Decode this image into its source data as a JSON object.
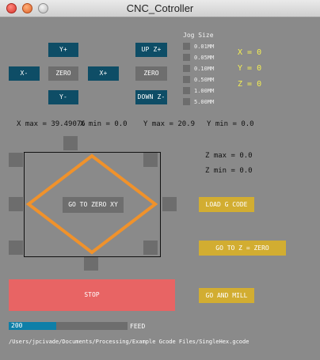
{
  "window": {
    "title": "CNC_Cotroller"
  },
  "jog_pad": {
    "y_plus": "Y+",
    "y_minus": "Y-",
    "x_minus": "X-",
    "x_plus": "X+",
    "zero": "ZERO"
  },
  "z_pad": {
    "up": "UP Z+",
    "zero": "ZERO",
    "down": "DOWN Z-"
  },
  "jog_size": {
    "title": "Jog  Size",
    "options": [
      "0.01MM",
      "0.05MM",
      "0.10MM",
      "0.50MM",
      "1.00MM",
      "5.00MM"
    ]
  },
  "position": {
    "x": "X = 0",
    "y": "Y = 0",
    "z": "Z = 0"
  },
  "limits": {
    "x_max": "X max = 39.49076",
    "x_min": "X min = 0.0",
    "y_max": "Y max = 20.9",
    "y_min": "Y min = 0.0",
    "z_max": "Z max = 0.0",
    "z_min": "Z min = 0.0"
  },
  "work_area": {
    "go_to_zero_xy": "GO TO ZERO XY"
  },
  "actions": {
    "load_gcode": "LOAD G CODE",
    "go_to_z_zero": "GO TO Z = ZERO",
    "go_and_mill": "GO AND MILL",
    "stop": "STOP"
  },
  "feed": {
    "value": 200,
    "max": 500,
    "value_text": "200",
    "label": "FEED"
  },
  "file_path": "/Users/jpcivade/Documents/Processing/Example Gcode Files/SingleHex.gcode",
  "colors": {
    "background": "#8a8a8a",
    "blue_button": "#0e4d66",
    "gray_button": "#6e6e6e",
    "gold_button": "#d2ad31",
    "stop_button": "#e86464",
    "toolpath": "#f0922b",
    "feed_bar": "#0e7fa8",
    "position_text": "#f4ef52"
  }
}
